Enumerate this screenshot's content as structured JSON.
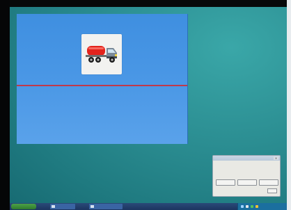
{
  "desktop": {
    "background_color": "#2c8f93"
  },
  "canvas_window": {
    "background_color": "#4b98e6",
    "guide_line_color": "#c0394a",
    "tile_icon": "tanker-truck-icon"
  },
  "dialog": {
    "title": "",
    "close_symbol": "×",
    "message": "",
    "buttons": [
      "",
      "",
      ""
    ],
    "ok_label": ""
  },
  "taskbar": {
    "start_label": "",
    "tasks": [
      {
        "label": ""
      },
      {
        "label": ""
      }
    ],
    "tray_icons": [
      "network-icon",
      "volume-icon",
      "security-icon",
      "update-icon"
    ],
    "clock": ""
  }
}
